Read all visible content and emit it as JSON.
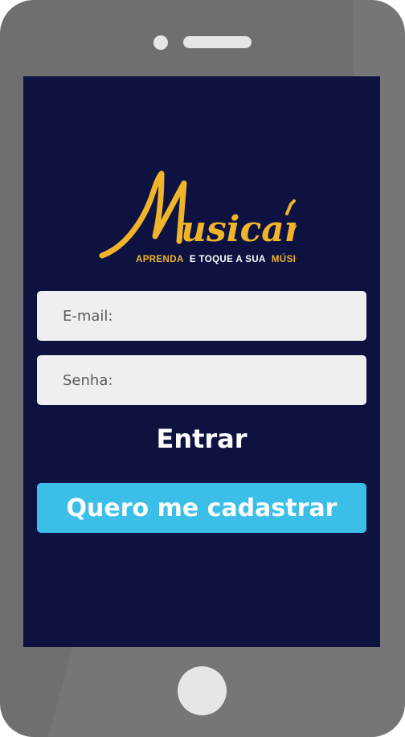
{
  "logo": {
    "name": "Musicar",
    "tagline_parts": [
      "APRENDA",
      "E TOQUE A SUA",
      "MÚSICA"
    ],
    "colors": {
      "gold": "#f0b42b",
      "white": "#ffffff"
    }
  },
  "form": {
    "email_label": "E-mail:",
    "password_label": "Senha:",
    "login_label": "Entrar",
    "signup_label": "Quero me cadastrar"
  },
  "colors": {
    "phone_body": "#6f6f6f",
    "screen_bg": "#0e1240",
    "field_bg": "#efefef",
    "signup_bg": "#3bbfe8"
  }
}
